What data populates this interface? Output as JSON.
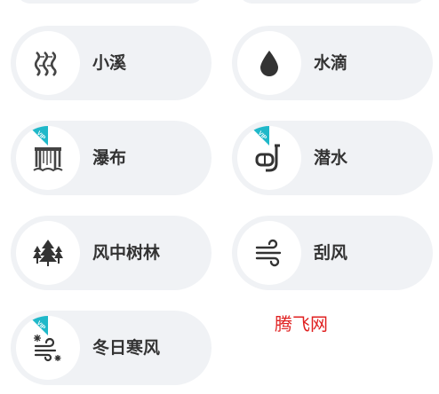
{
  "sounds": [
    {
      "label": "小溪",
      "icon": "stream-icon",
      "vip": false
    },
    {
      "label": "水滴",
      "icon": "water-drop-icon",
      "vip": false
    },
    {
      "label": "瀑布",
      "icon": "waterfall-icon",
      "vip": true
    },
    {
      "label": "潜水",
      "icon": "snorkel-icon",
      "vip": true
    },
    {
      "label": "风中树林",
      "icon": "forest-icon",
      "vip": false
    },
    {
      "label": "刮风",
      "icon": "wind-icon",
      "vip": false
    },
    {
      "label": "冬日寒风",
      "icon": "winter-wind-icon",
      "vip": true
    }
  ],
  "vip_badge": "VIP",
  "watermark": "腾飞网",
  "colors": {
    "vip_badge": "#1fb8c9",
    "card_bg": "#f0f2f5",
    "label": "#333333",
    "watermark": "#e02020"
  }
}
